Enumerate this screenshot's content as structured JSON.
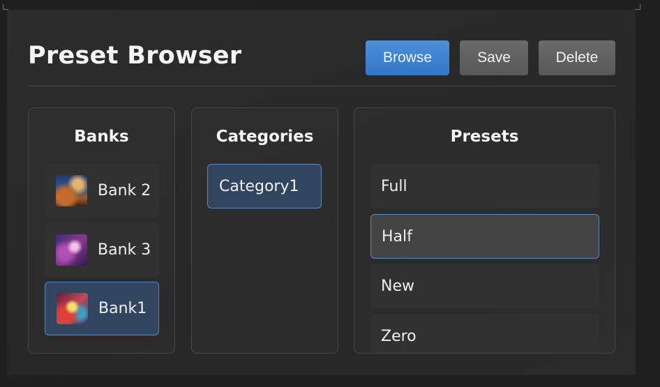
{
  "header": {
    "title": "Preset Browser",
    "buttons": {
      "browse": "Browse",
      "save": "Save",
      "delete": "Delete"
    }
  },
  "banks": {
    "title": "Banks",
    "items": [
      {
        "label": "Bank 2",
        "thumbnail": "galaxy-thumbnail"
      },
      {
        "label": "Bank 3",
        "thumbnail": "nebula-thumbnail"
      },
      {
        "label": "Bank1",
        "thumbnail": "nebula-thumbnail",
        "selected": true
      }
    ]
  },
  "categories": {
    "title": "Categories",
    "items": [
      {
        "label": "Category1",
        "selected": true
      }
    ]
  },
  "presets": {
    "title": "Presets",
    "items": [
      {
        "label": "Full"
      },
      {
        "label": "Half",
        "highlighted": true
      },
      {
        "label": "New"
      },
      {
        "label": "Zero"
      }
    ]
  },
  "colors": {
    "accent": "#3f86d4",
    "selected_background": "#31455e",
    "selected_border": "#5b87c0",
    "panel_background": "#2a2a2a"
  }
}
